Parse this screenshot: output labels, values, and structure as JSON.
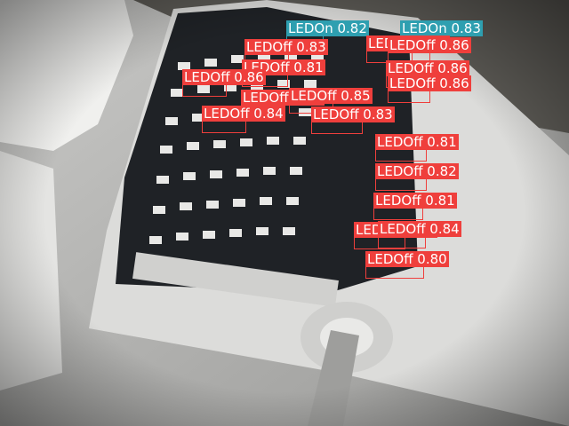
{
  "colors": {
    "off": "#ef3f3c",
    "on": "#2e9fb0"
  },
  "detections": [
    {
      "label": "LEDOn",
      "score": "0.82",
      "state": "on"
    },
    {
      "label": "LEDOn",
      "score": "0.83",
      "state": "on"
    },
    {
      "label": "LEDOff",
      "score": "0.83",
      "state": "off"
    },
    {
      "label": "LEDOff",
      "score": "0.84",
      "state": "off"
    },
    {
      "label": "LEDOff",
      "score": "0.86",
      "state": "off"
    },
    {
      "label": "LEDOff",
      "score": "0.81",
      "state": "off"
    },
    {
      "label": "LEDOff",
      "score": "0.86",
      "state": "off"
    },
    {
      "label": "LEDOff",
      "score": "0.86",
      "state": "off"
    },
    {
      "label": "LEDOff",
      "score": "0.86",
      "state": "off"
    },
    {
      "label": "LEDOff",
      "score": "0.83",
      "state": "off"
    },
    {
      "label": "LEDOff",
      "score": "0.85",
      "state": "off"
    },
    {
      "label": "LEDOff",
      "score": "0.84",
      "state": "off"
    },
    {
      "label": "LEDOff",
      "score": "0.83",
      "state": "off"
    },
    {
      "label": "LEDOff",
      "score": "0.81",
      "state": "off"
    },
    {
      "label": "LEDOff",
      "score": "0.82",
      "state": "off"
    },
    {
      "label": "LEDOff",
      "score": "0.81",
      "state": "off"
    },
    {
      "label": "LEDOff",
      "score": "0.83",
      "state": "off"
    },
    {
      "label": "LEDOff",
      "score": "0.84",
      "state": "off"
    },
    {
      "label": "LEDOff",
      "score": "0.80",
      "state": "off"
    }
  ]
}
